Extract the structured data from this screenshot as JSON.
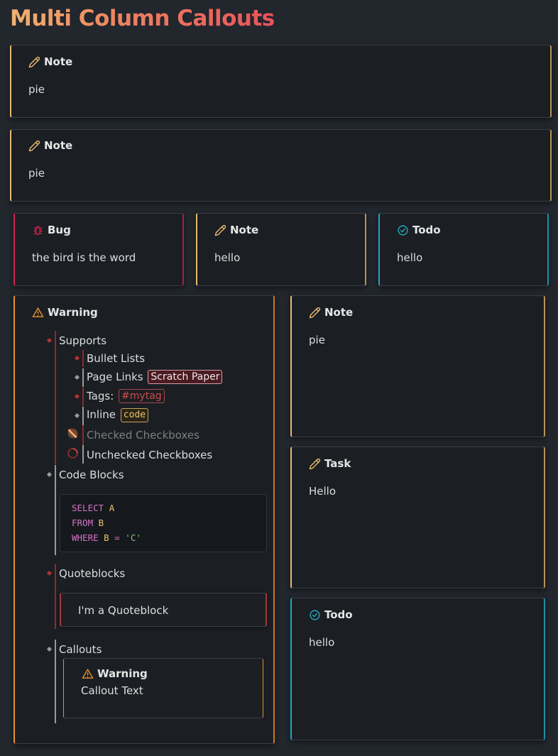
{
  "page": {
    "title": "Multi Column Callouts"
  },
  "colors": {
    "note": "#e9b96e",
    "bug": "#d4244e",
    "todo": "#25a6bd",
    "warning": "#e8912c",
    "background": "#22262d",
    "callout_bg": "#1b1e23"
  },
  "callouts": {
    "note1": {
      "icon": "pencil-icon",
      "title": "Note",
      "body": "pie"
    },
    "note2": {
      "icon": "pencil-icon",
      "title": "Note",
      "body": "pie"
    },
    "bug": {
      "icon": "bug-icon",
      "title": "Bug",
      "body": "the bird is the word"
    },
    "note3": {
      "icon": "pencil-icon",
      "title": "Note",
      "body": "hello"
    },
    "todo1": {
      "icon": "check-circle-icon",
      "title": "Todo",
      "body": "hello"
    },
    "warning": {
      "icon": "warning-icon",
      "title": "Warning",
      "supports": "Supports",
      "bullet_lists": "Bullet Lists",
      "page_links": "Page Links",
      "page_link": "Scratch Paper",
      "tags": "Tags:",
      "tag": "#mytag",
      "inline": "Inline",
      "inline_code": "code",
      "checked": "Checked Checkboxes",
      "unchecked": "Unchecked Checkboxes",
      "code_blocks": "Code Blocks",
      "code": {
        "l1_kw": "SELECT",
        "l1_id": "A",
        "l2_kw": "FROM",
        "l2_id": "B",
        "l3_kw": "WHERE",
        "l3_id": "B",
        "l3_op": "=",
        "l3_str": "'C'"
      },
      "quoteblocks": "Quoteblocks",
      "quote_text": "I'm a Quoteblock",
      "callouts": "Callouts",
      "inner": {
        "icon": "warning-icon",
        "title": "Warning",
        "body": "Callout Text"
      }
    },
    "note4": {
      "icon": "pencil-icon",
      "title": "Note",
      "body": "pie"
    },
    "task": {
      "icon": "pencil-icon",
      "title": "Task",
      "body": "Hello"
    },
    "todo2": {
      "icon": "check-circle-icon",
      "title": "Todo",
      "body": "hello"
    }
  }
}
